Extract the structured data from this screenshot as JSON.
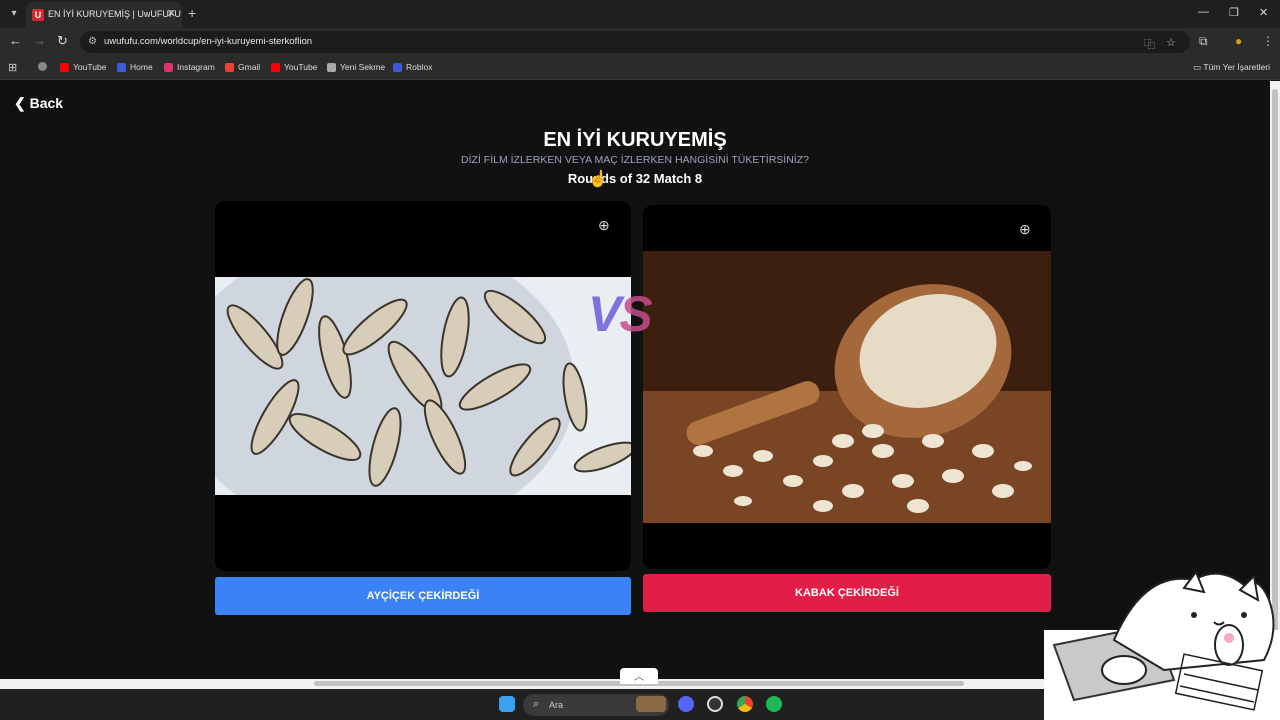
{
  "browser": {
    "tab_title": "EN İYİ KURUYEMİŞ | UwUFUFU",
    "tab_favicon_letter": "U",
    "url": "uwufufu.com/worldcup/en-iyi-kuruyemi-sterkoflion"
  },
  "bookmarks": [
    {
      "label": "YouTube",
      "color": "#ff0000"
    },
    {
      "label": "Home",
      "color": "#3b5bdb"
    },
    {
      "label": "Instagram",
      "color": "#e1306c"
    },
    {
      "label": "Gmail",
      "color": "#ea4335"
    },
    {
      "label": "YouTube",
      "color": "#ff0000"
    },
    {
      "label": "Yeni Sekme",
      "color": "#aaaaaa"
    },
    {
      "label": "Roblox",
      "color": "#3b5bdb"
    }
  ],
  "bookmarks_all": "Tüm Yer İşaretleri",
  "page": {
    "back_label": "Back",
    "title": "EN İYİ KURUYEMİŞ",
    "subtitle": "DİZİ FİLM İZLERKEN VEYA MAÇ İZLERKEN HANGİSİNİ TÜKETİRSİNİZ?",
    "round": "Rounds of 32 Match 8",
    "vs_left": "V",
    "vs_right": "S"
  },
  "choices": {
    "left_label": "AYÇİÇEK ÇEKİRDEĞİ",
    "left_color": "#3b82f6",
    "right_label": "KABAK ÇEKİRDEĞİ",
    "right_color": "#e11d48"
  },
  "taskbar": {
    "search_placeholder": "Ara"
  }
}
